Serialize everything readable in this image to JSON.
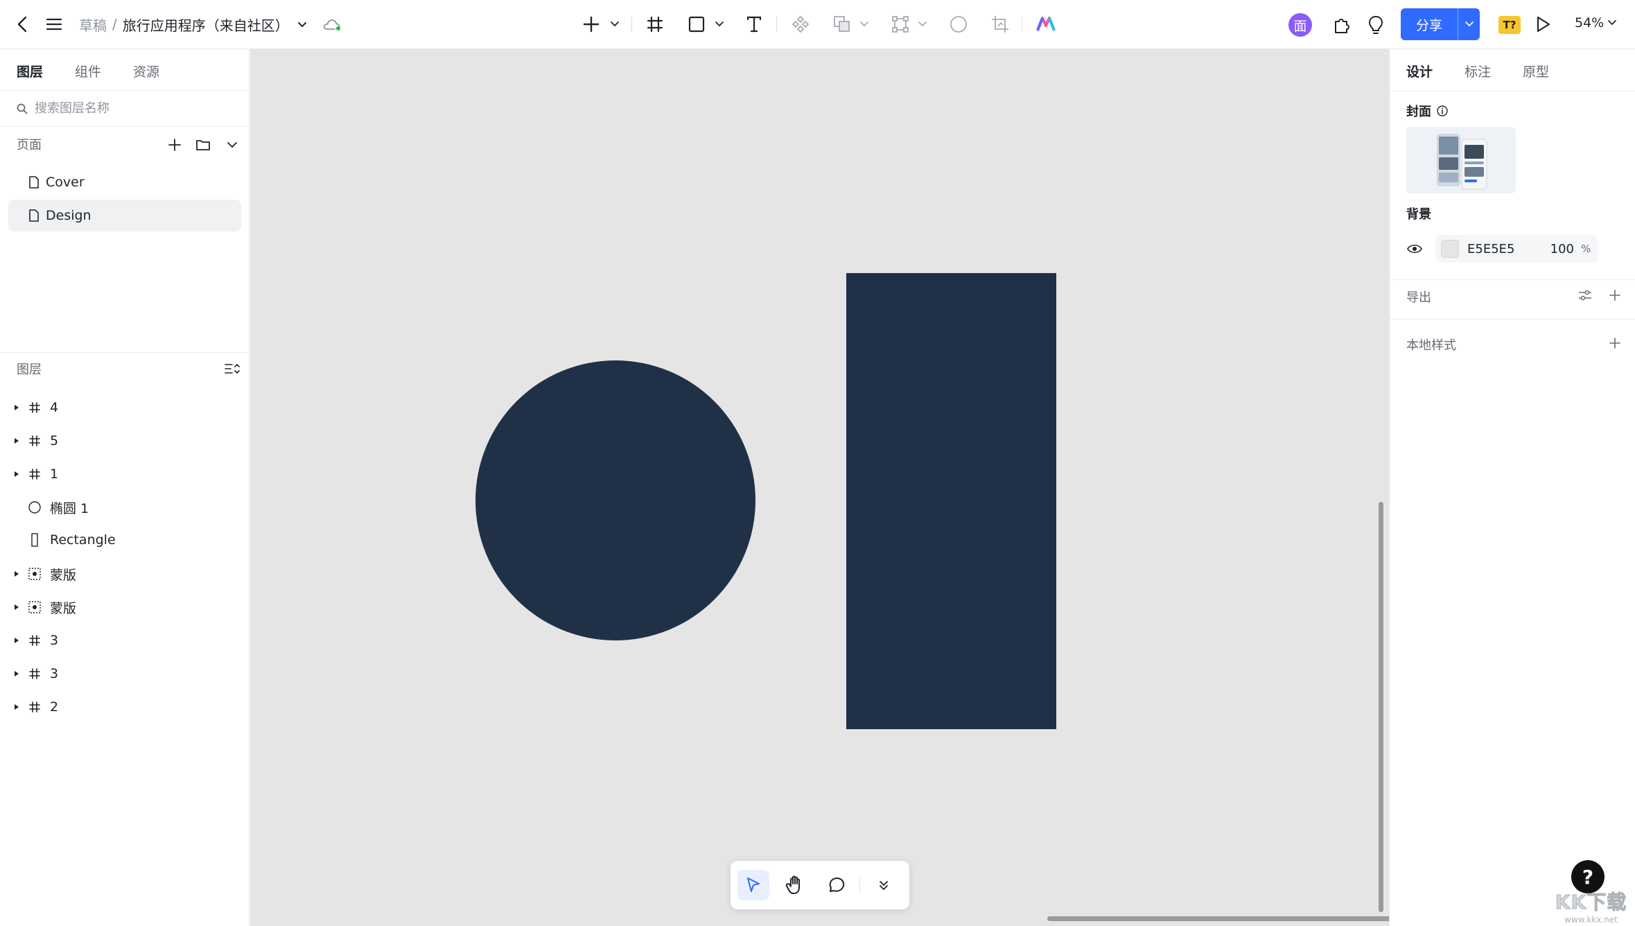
{
  "app": {
    "breadcrumb": {
      "parent": "草稿",
      "separator": "/",
      "file_name": "旅行应用程序（来自社区）"
    },
    "avatar_initial": "面",
    "share_label": "分享",
    "badge_label": "T?",
    "zoom_level": "54%"
  },
  "left_panel": {
    "tabs": [
      "图层",
      "组件",
      "资源"
    ],
    "active_tab": "图层",
    "search_placeholder": "搜索图层名称",
    "pages_title": "页面",
    "pages": [
      {
        "label": "Cover",
        "selected": false
      },
      {
        "label": "Design",
        "selected": true
      }
    ],
    "layers_title": "图层",
    "layers": [
      {
        "label": "4",
        "type": "frame",
        "expandable": true
      },
      {
        "label": "5",
        "type": "frame",
        "expandable": true
      },
      {
        "label": "1",
        "type": "frame",
        "expandable": true
      },
      {
        "label": "椭圆 1",
        "type": "ellipse",
        "expandable": false
      },
      {
        "label": "Rectangle",
        "type": "rectangle",
        "expandable": false
      },
      {
        "label": "蒙版",
        "type": "mask",
        "expandable": true
      },
      {
        "label": "蒙版",
        "type": "mask",
        "expandable": true
      },
      {
        "label": "3",
        "type": "frame",
        "expandable": true
      },
      {
        "label": "3",
        "type": "frame",
        "expandable": true
      },
      {
        "label": "2",
        "type": "frame",
        "expandable": true
      }
    ]
  },
  "canvas": {
    "background": "#E5E5E5",
    "shape_color": "#1F3047"
  },
  "right_panel": {
    "tabs": [
      "设计",
      "标注",
      "原型"
    ],
    "active_tab": "设计",
    "cover_title": "封面",
    "background_title": "背景",
    "background_hex": "E5E5E5",
    "background_opacity": "100",
    "background_opacity_unit": "%",
    "export_title": "导出",
    "local_styles_title": "本地样式"
  },
  "watermark": {
    "main": "KK下载",
    "sub": "www.kkx.net"
  },
  "colors": {
    "accent": "#2F6BFF",
    "avatar": "#8B5CF6",
    "badge": "#F7C52D"
  }
}
